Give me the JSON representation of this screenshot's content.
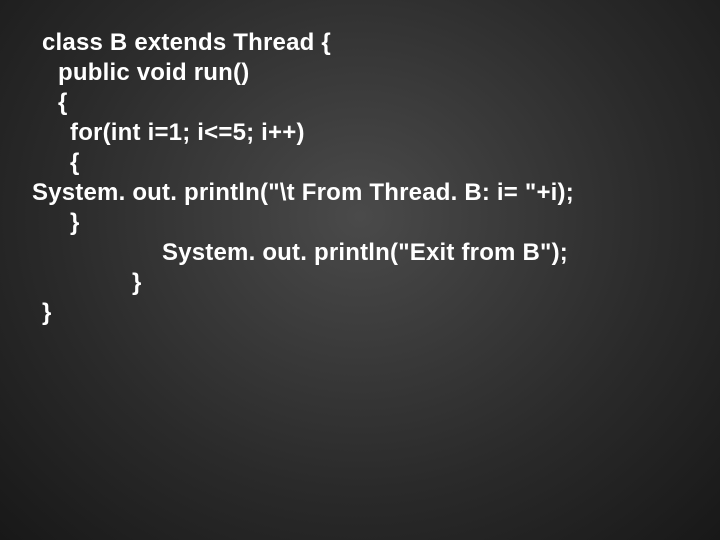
{
  "code": {
    "l1": "class B extends Thread {",
    "l2": "public void run()",
    "l3": "{",
    "l4": "for(int i=1; i<=5; i++)",
    "l5": "{",
    "l6": "System. out. println(\"\\t From Thread. B: i= \"+i);",
    "l7": "}",
    "l8": "System. out. println(\"Exit from B\");",
    "l9": "}",
    "l10": "}"
  }
}
